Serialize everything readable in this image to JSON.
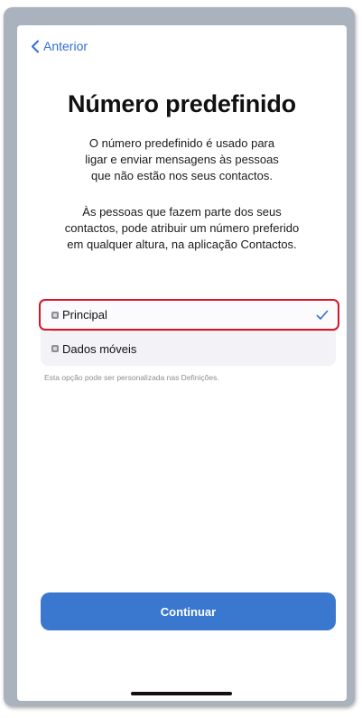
{
  "nav": {
    "back_label": "Anterior"
  },
  "title": "Número predefinido",
  "description": [
    "O número predefinido é usado para",
    "ligar e enviar mensagens às pessoas",
    "que não estão nos seus contactos."
  ],
  "description2": [
    "Às pessoas que fazem parte dos seus",
    "contactos, pode atribuir um número preferido",
    "em qualquer altura, na aplicação Contactos."
  ],
  "options": [
    {
      "label": "Principal",
      "icon": "sim-icon",
      "selected": true
    },
    {
      "label": "Dados móveis",
      "icon": "sim-icon",
      "selected": false
    }
  ],
  "hint": "Esta opção pode ser personalizada nas Definições.",
  "continue_label": "Continuar",
  "colors": {
    "accent": "#3a78cf",
    "highlight": "#d7152a",
    "link": "#2f6fd6"
  }
}
